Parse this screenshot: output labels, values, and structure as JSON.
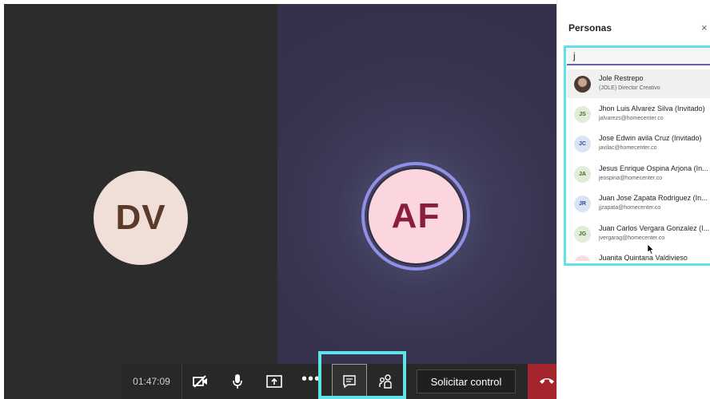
{
  "participants": {
    "left": {
      "initials": "DV"
    },
    "right": {
      "initials": "AF"
    }
  },
  "toolbar": {
    "timer": "01:47:09",
    "buttons": [
      {
        "icon": "video-off-icon"
      },
      {
        "icon": "microphone-icon"
      },
      {
        "icon": "share-screen-icon"
      },
      {
        "icon": "more-options-icon",
        "label": "•••"
      },
      {
        "icon": "chat-icon"
      },
      {
        "icon": "participants-icon"
      }
    ],
    "request_control_label": "Solicitar control",
    "hangup_icon": "hang-up-icon"
  },
  "people_panel": {
    "title": "Personas",
    "close_label": "×",
    "search_value": "j",
    "people": [
      {
        "name": "Jole Restrepo",
        "sub": "(JOLE) Director Creativo",
        "initials": "",
        "avatar": "photo"
      },
      {
        "name": "Jhon Luis Alvarez Silva (Invitado)",
        "sub": "jalvarezs@homecenter.co",
        "initials": "JS",
        "avatar_color": "#e2edd9",
        "initials_color": "#3f6b28"
      },
      {
        "name": "Jose Edwin avila Cruz (Invitado)",
        "sub": "javilac@homecenter.co",
        "initials": "JC",
        "avatar_color": "#dbe4f5",
        "initials_color": "#2f4f8a"
      },
      {
        "name": "Jesus Enrique Ospina Arjona (In...",
        "sub": "jeospina@homecenter.co",
        "initials": "JA",
        "avatar_color": "#e2edd9",
        "initials_color": "#3f6b28"
      },
      {
        "name": "Juan Jose Zapata Rodriguez (In...",
        "sub": "jjzapata@homecenter.co",
        "initials": "JR",
        "avatar_color": "#dbe4f5",
        "initials_color": "#2f4f8a"
      },
      {
        "name": "Juan Carlos Vergara Gonzalez (I...",
        "sub": "jvergarag@homecenter.co",
        "initials": "JG",
        "avatar_color": "#e2edd9",
        "initials_color": "#3f6b28"
      },
      {
        "name": "Juanita Quintana Valdivieso",
        "sub": "",
        "initials": "",
        "avatar_color": "#fbdde6",
        "initials_color": "#8a1c3c"
      }
    ]
  },
  "colors": {
    "accent": "#6264a7",
    "hangup": "#a4262c",
    "highlight": "#5fe3e8"
  }
}
